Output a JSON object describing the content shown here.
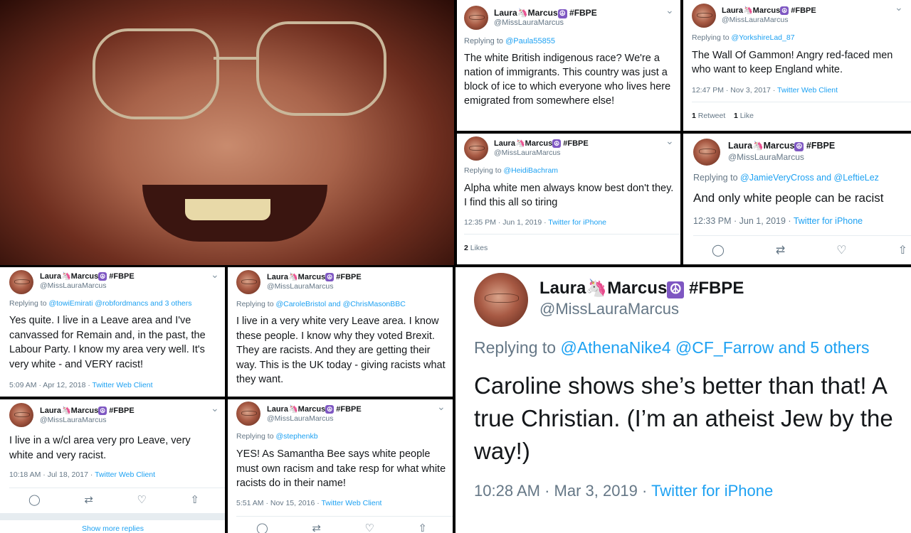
{
  "photo": {
    "description_icon": "portrait-photo"
  },
  "user": {
    "name": "Laura",
    "name2": "Marcus",
    "tag": "#FBPE",
    "handle": "@MissLauraMarcus",
    "unicorn": "🦄",
    "peace": "☮"
  },
  "tweets": [
    {
      "reply_prefix": "Replying to ",
      "reply_to": "@Paula55855",
      "text": "The white British indigenous race? We're a nation of immigrants. This country was just a block of ice to which everyone who lives here emigrated from somewhere else!"
    },
    {
      "reply_prefix": "Replying to ",
      "reply_to": "@YorkshireLad_87",
      "text": "The Wall Of Gammon! Angry red-faced men who want to keep England white.",
      "time": "12:47 PM · Nov 3, 2017 · ",
      "client": "Twitter Web Client",
      "stat1_num": "1",
      "stat1_label": " Retweet",
      "stat2_num": "1",
      "stat2_label": " Like"
    },
    {
      "reply_prefix": "Replying to ",
      "reply_to": "@HeidiBachram",
      "text": "Alpha white men always know best don't they. I find this all so tiring",
      "time": "12:35 PM · Jun 1, 2019 · ",
      "client": "Twitter for iPhone",
      "stat1_num": "2",
      "stat1_label": " Likes"
    },
    {
      "reply_prefix": "Replying to ",
      "reply_to": "@JamieVeryCross and @LeftieLez",
      "text": "And only white people can be racist",
      "time": "12:33 PM · Jun 1, 2019 · ",
      "client": "Twitter for iPhone"
    },
    {
      "reply_prefix": "Replying to ",
      "reply_to": "@towiEmirati @robfordmancs and 3 others",
      "text": "Yes quite. I live in a Leave area and I've canvassed for Remain and, in the past, the Labour Party. I know my area very well. It's very white - and VERY racist!",
      "time": "5:09 AM · Apr 12, 2018 · ",
      "client": "Twitter Web Client"
    },
    {
      "reply_prefix": "Replying to ",
      "reply_to": "@CaroleBristol and @ChrisMasonBBC",
      "text": "I live in a very white very Leave area. I know these people. I know why they voted Brexit. They are racists. And they are getting their way. This is the UK today - giving racists what they want."
    },
    {
      "text": "I live in a w/cl area very pro Leave, very white and very racist.",
      "time": "10:18 AM · Jul 18, 2017 · ",
      "client": "Twitter Web Client",
      "show_more": "Show more replies"
    },
    {
      "reply_prefix": "Replying to ",
      "reply_to": "@stephenkb",
      "text": "YES! As Samantha Bee says white people must own racism and take resp for what white racists do in their name!",
      "time": "5:51 AM · Nov 15, 2016 · ",
      "client": "Twitter Web Client"
    },
    {
      "reply_prefix": "Replying to ",
      "reply_to": "@AthenaNike4 @CF_Farrow and 5 others",
      "text": "Caroline shows she’s better than that! A true Christian. (I’m an atheist Jew by the way!)",
      "time": "10:28 AM · Mar 3, 2019 · ",
      "client": "Twitter for iPhone"
    }
  ],
  "icons": {
    "chevron": "⌄",
    "reply": "◯",
    "retweet": "⇄",
    "like": "♡",
    "share": "⇧"
  }
}
